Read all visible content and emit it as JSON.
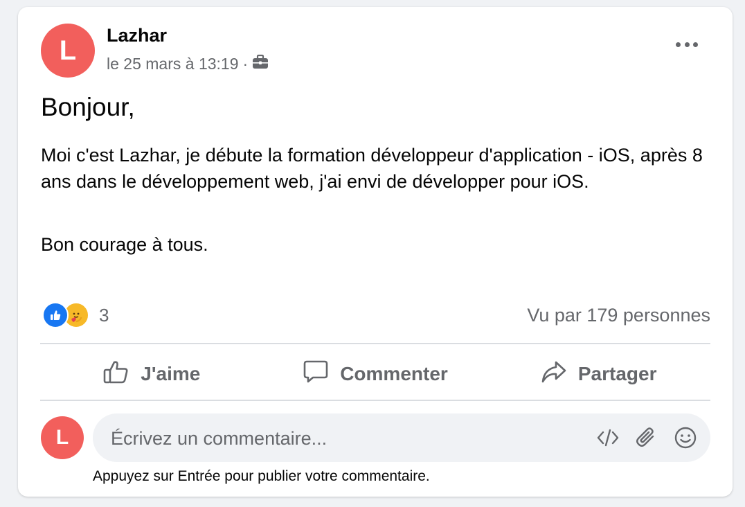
{
  "post": {
    "author_initial": "L",
    "author": "Lazhar",
    "timestamp": "le 25 mars à 13:19",
    "separator": "·",
    "audience_icon": "briefcase-icon",
    "greeting": "Bonjour,",
    "paragraph1": "Moi c'est Lazhar, je débute la formation développeur d'application - iOS, après 8 ans dans le développement web, j'ai envi de développer pour iOS.",
    "paragraph2": "Bon courage à tous.",
    "reaction_icons": [
      "like-reaction-icon",
      "care-reaction-icon"
    ],
    "reaction_count": "3",
    "views": "Vu par 179 personnes"
  },
  "actions": {
    "like": "J'aime",
    "comment": "Commenter",
    "share": "Partager"
  },
  "composer": {
    "avatar_initial": "L",
    "placeholder": "Écrivez un commentaire...",
    "value": "",
    "icons": [
      "code-icon",
      "paperclip-icon",
      "emoji-icon"
    ],
    "hint": "Appuyez sur Entrée pour publier votre commentaire."
  },
  "colors": {
    "avatar": "#f25f5c",
    "like_blue": "#1877f2",
    "care_yellow": "#f7b928",
    "muted_text": "#65676b"
  }
}
